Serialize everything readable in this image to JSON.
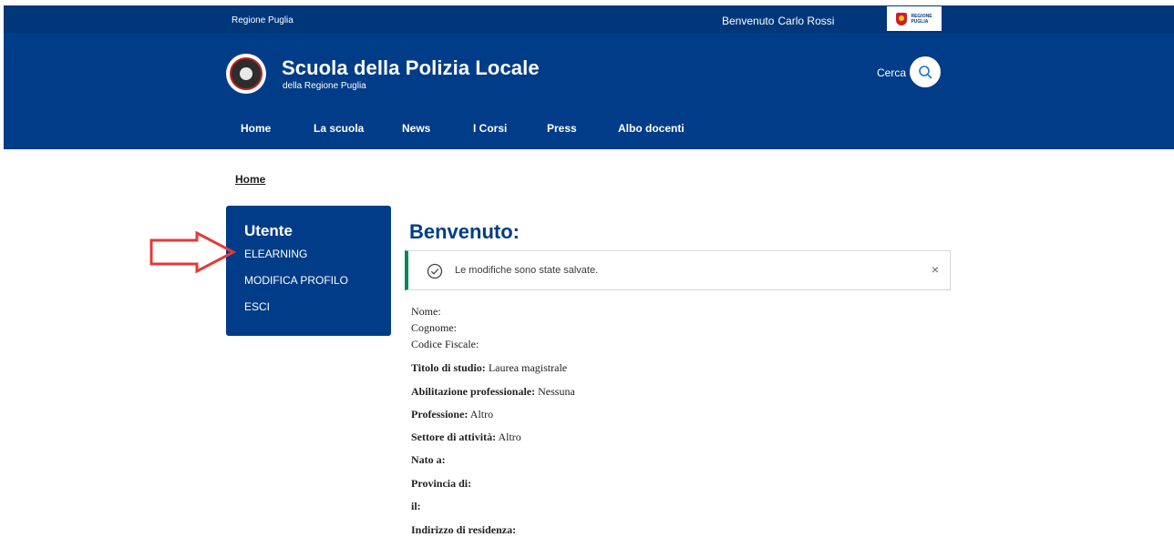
{
  "topbar": {
    "region": "Regione Puglia",
    "welcome": "Benvenuto",
    "user": "Carlo Rossi",
    "logo_text": [
      "REGIONE",
      "PUGLIA"
    ]
  },
  "header": {
    "title": "Scuola della Polizia Locale",
    "subtitle": "della Regione Puglia",
    "search_label": "Cerca"
  },
  "nav": [
    "Home",
    "La scuola",
    "News",
    "I Corsi",
    "Press",
    "Albo docenti"
  ],
  "breadcrumb": "Home",
  "sidebar": {
    "title": "Utente",
    "items": [
      "ELEARNING",
      "MODIFICA PROFILO",
      "ESCI"
    ]
  },
  "main": {
    "title": "Benvenuto:",
    "alert": {
      "message": "Le modifiche sono state salvate.",
      "close": "×"
    },
    "plain_fields": [
      "Nome:",
      "Cognome:",
      "Codice Fiscale:"
    ],
    "fields": [
      {
        "label": "Titolo di studio:",
        "value": "Laurea magistrale"
      },
      {
        "label": "Abilitazione professionale:",
        "value": "Nessuna"
      },
      {
        "label": "Professione:",
        "value": "Altro"
      },
      {
        "label": "Settore di attività:",
        "value": "Altro"
      },
      {
        "label": "Nato a:",
        "value": ""
      },
      {
        "label": "Provincia di:",
        "value": ""
      },
      {
        "label": "il:",
        "value": ""
      },
      {
        "label": "Indirizzo di residenza:",
        "value": ""
      }
    ]
  },
  "colors": {
    "primary": "#003c87",
    "topbar": "#00367a",
    "success": "#008758",
    "annotation": "#e53935"
  }
}
